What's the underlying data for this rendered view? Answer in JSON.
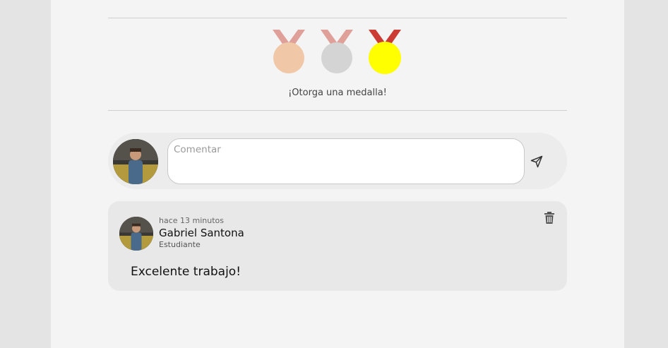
{
  "medals": {
    "bronze": {
      "name": "bronze-medal",
      "ribbon": "#e0a09a",
      "disc": "#f0c8a8"
    },
    "silver": {
      "name": "silver-medal",
      "ribbon": "#e0a09a",
      "disc": "#d4d4d4"
    },
    "gold": {
      "name": "gold-medal",
      "ribbon": "#cc3b33",
      "disc": "#ffff00"
    },
    "caption": "¡Otorga una medalla!"
  },
  "composer": {
    "placeholder": "Comentar",
    "value": "",
    "send_icon": "send-icon"
  },
  "comments": [
    {
      "time": "hace 13 minutos",
      "author": "Gabriel Santona",
      "role": "Estudiante",
      "text": "Excelente trabajo!",
      "delete_icon": "trash-icon"
    }
  ]
}
